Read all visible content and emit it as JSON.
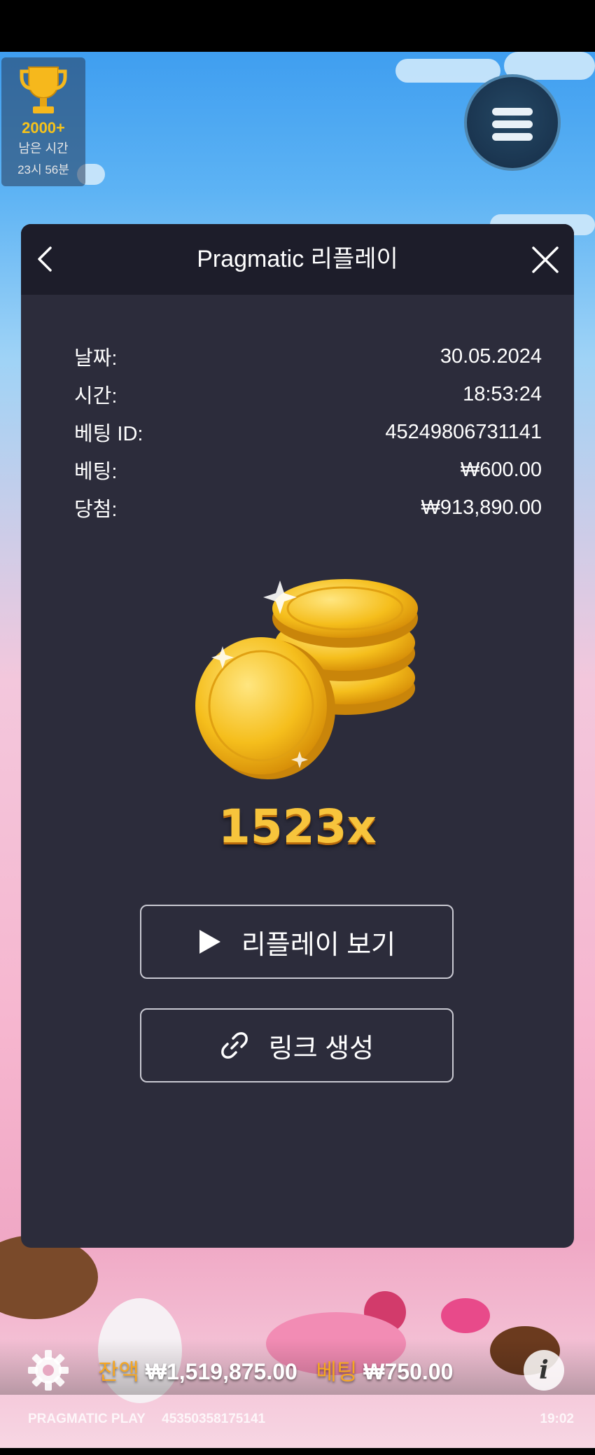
{
  "trophy": {
    "count": "2000+",
    "label": "남은 시간",
    "time": "23시 56분"
  },
  "panel": {
    "title": "Pragmatic 리플레이",
    "details": [
      {
        "label": "날짜:",
        "value": "30.05.2024"
      },
      {
        "label": "시간:",
        "value": "18:53:24"
      },
      {
        "label": "베팅 ID:",
        "value": "45249806731141"
      },
      {
        "label": "베팅:",
        "value": "₩600.00"
      },
      {
        "label": "당첨:",
        "value": "₩913,890.00"
      }
    ],
    "multiplier": "1523x",
    "watch_replay_label": "리플레이 보기",
    "create_link_label": "링크 생성"
  },
  "bottom": {
    "balance_label": "잔액",
    "balance_value": "₩1,519,875.00",
    "bet_label": "베팅",
    "bet_value": "₩750.00",
    "brand": "PRAGMATIC PLAY",
    "session_id": "45350358175141",
    "clock": "19:02"
  },
  "icons": {
    "trophy": "trophy-icon",
    "menu": "hamburger-icon",
    "back": "chevron-left-icon",
    "close": "close-icon",
    "play": "play-icon",
    "link": "link-icon",
    "settings": "gear-icon",
    "info": "info-icon"
  },
  "colors": {
    "panel_bg": "#2c2c3b",
    "header_bg": "#1d1d2a",
    "gold": "#f7c43c",
    "orange_label": "#f5a623"
  }
}
